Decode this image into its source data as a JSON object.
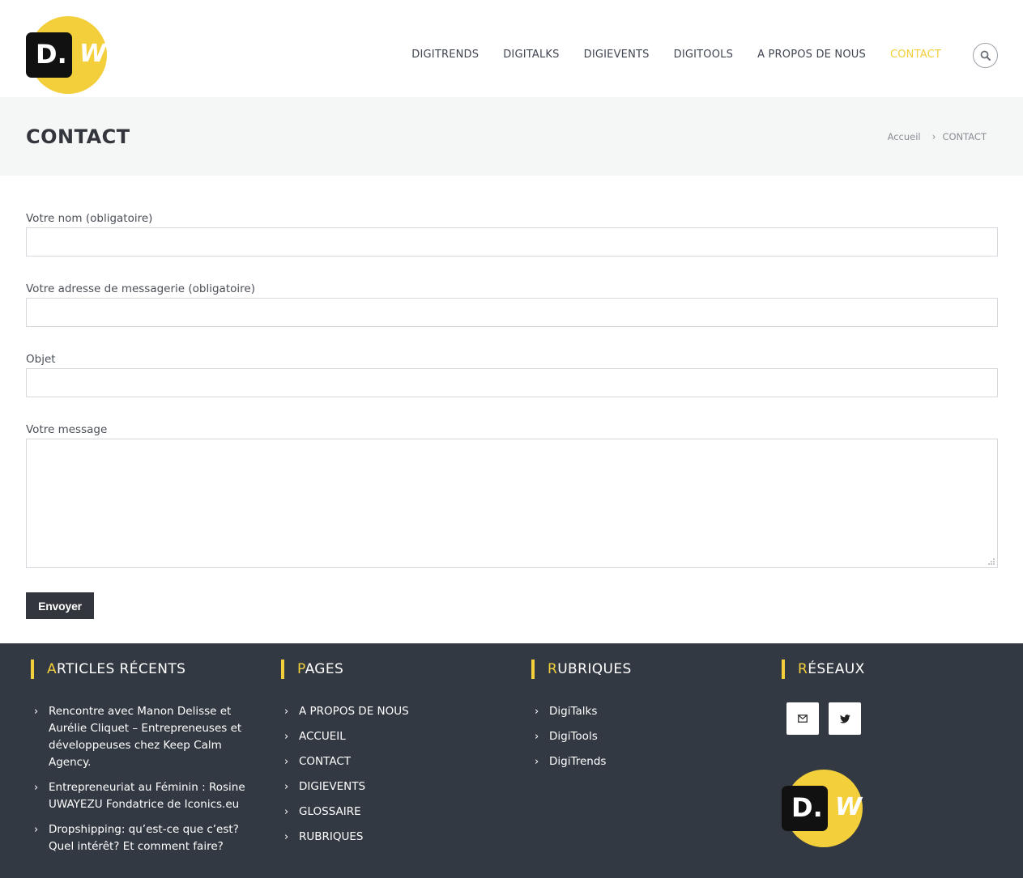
{
  "header": {
    "logo_letter": "D.",
    "logo_w": "W",
    "nav": [
      {
        "label": "DIGITRENDS",
        "active": false
      },
      {
        "label": "DIGITALKS",
        "active": false
      },
      {
        "label": "DIGIEVENTS",
        "active": false
      },
      {
        "label": "DIGITOOLS",
        "active": false
      },
      {
        "label": "A PROPOS DE NOUS",
        "active": false
      },
      {
        "label": "CONTACT",
        "active": true
      }
    ],
    "search_icon": "search-icon"
  },
  "titlebar": {
    "title": "CONTACT",
    "breadcrumb": {
      "home": "Accueil",
      "separator": "›",
      "current": "CONTACT"
    }
  },
  "form": {
    "name_label": "Votre nom (obligatoire)",
    "name_value": "",
    "email_label": "Votre adresse de messagerie (obligatoire)",
    "email_value": "",
    "subject_label": "Objet",
    "subject_value": "",
    "message_label": "Votre message",
    "message_value": "",
    "submit_label": "Envoyer"
  },
  "footer": {
    "recent": {
      "head_first": "A",
      "head_rest": "RTICLES RÉCENTS",
      "items": [
        "Rencontre avec Manon Delisse et Aurélie Cliquet – Entrepreneuses et développeuses chez Keep Calm Agency.",
        "Entrepreneuriat au Féminin : Rosine UWAYEZU Fondatrice de Iconics.eu",
        "Dropshipping: qu’est-ce que c’est? Quel intérêt? Et comment faire?"
      ]
    },
    "pages": {
      "head_first": "P",
      "head_rest": "AGES",
      "items": [
        "A PROPOS DE NOUS",
        "ACCUEIL",
        "CONTACT",
        "DIGIEVENTS",
        "GLOSSAIRE",
        "RUBRIQUES"
      ]
    },
    "rubriques": {
      "head_first": "R",
      "head_rest": "UBRIQUES",
      "items": [
        "DigiTalks",
        "DigiTools",
        "DigiTrends"
      ]
    },
    "reseaux": {
      "head_first": "R",
      "head_rest": "ÉSEAUX",
      "icons": [
        "envelope-icon",
        "twitter-icon"
      ]
    }
  },
  "colors": {
    "accent": "#f2cf3b",
    "footer_bg": "#333942",
    "titlebar_bg": "#f5f6f6",
    "button_bg": "#33373d"
  }
}
